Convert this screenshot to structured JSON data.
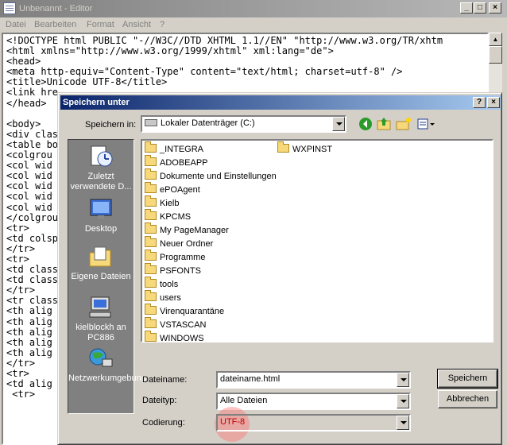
{
  "editor": {
    "title": "Unbenannt - Editor",
    "menu": [
      "Datei",
      "Bearbeiten",
      "Format",
      "Ansicht",
      "?"
    ],
    "lines": [
      "<!DOCTYPE html PUBLIC \"-//W3C//DTD XHTML 1.1//EN\" \"http://www.w3.org/TR/xhtm",
      "<html xmlns=\"http://www.w3.org/1999/xhtml\" xml:lang=\"de\">",
      "<head>",
      "<meta http-equiv=\"Content-Type\" content=\"text/html; charset=utf-8\" />",
      "<title>Unicode UTF-8</title>",
      "<link hre",
      "</head>",
      "",
      "<body>",
      "<div clas",
      "<table bo",
      "<colgrou",
      "<col wid",
      "<col wid",
      "<col wid",
      "<col wid",
      "<col wid",
      "</colgrou",
      "<tr>",
      "<td colsp",
      "</tr>",
      "<tr>",
      "<td class",
      "<td class",
      "</tr>",
      "<tr class",
      "<th alig",
      "<th alig",
      "<th alig",
      "<th alig",
      "<th alig",
      "</tr>",
      "<tr>",
      "<td alig",
      " <tr>"
    ]
  },
  "dialog": {
    "title": "Speichern unter",
    "save_in_label": "Speichern in:",
    "save_in_value": "Lokaler Datenträger (C:)",
    "places": [
      {
        "label": "Zuletzt verwendete D...",
        "icon": "recent-documents-icon"
      },
      {
        "label": "Desktop",
        "icon": "desktop-icon"
      },
      {
        "label": "Eigene Dateien",
        "icon": "my-documents-icon"
      },
      {
        "label": "kielblockh an PC886",
        "icon": "my-computer-icon"
      },
      {
        "label": "Netzwerkumgebung",
        "icon": "network-places-icon"
      }
    ],
    "folders_col1": [
      "_INTEGRA",
      "ADOBEAPP",
      "Dokumente und Einstellungen",
      "ePOAgent",
      "Kielb",
      "KPCMS",
      "My PageManager",
      "Neuer Ordner",
      "Programme",
      "PSFONTS",
      "tools",
      "users",
      "Virenquarantäne",
      "VSTASCAN",
      "WINDOWS"
    ],
    "folders_col2": [
      "WXPINST"
    ],
    "filename_label": "Dateiname:",
    "filename_value": "dateiname.html",
    "filetype_label": "Dateityp:",
    "filetype_value": "Alle Dateien",
    "encoding_label": "Codierung:",
    "encoding_value": "UTF-8",
    "save_button": "Speichern",
    "cancel_button": "Abbrechen",
    "help_glyph": "?",
    "close_glyph": "×"
  },
  "colors": {
    "dialog_title_start": "#0a246a",
    "dialog_title_end": "#a6caf0",
    "encoding_text": "#c00000",
    "highlight": "#ff7878"
  }
}
